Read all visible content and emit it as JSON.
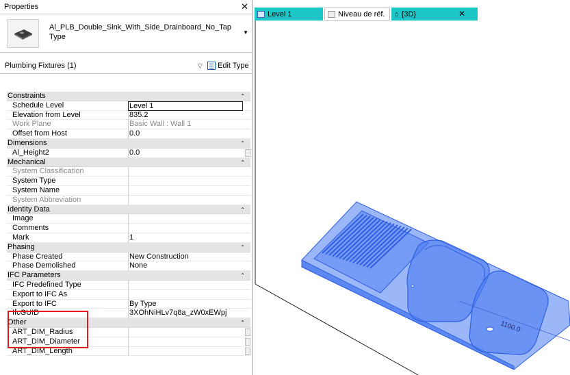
{
  "properties": {
    "title": "Properties",
    "close": "✕",
    "type_name": "Al_PLB_Double_Sink_With_Side_Drainboard_No_Tap",
    "type_sub": "Type",
    "filter": "Plumbing Fixtures (1)",
    "edit_type": "Edit Type",
    "groups": [
      {
        "name": "Constraints",
        "rows": [
          {
            "label": "Schedule Level",
            "value": "Level 1",
            "editing": true
          },
          {
            "label": "Elevation from Level",
            "value": "835.2"
          },
          {
            "label": "Work Plane",
            "value": "Basic Wall : Wall 1",
            "disabled": true
          },
          {
            "label": "Offset from Host",
            "value": "0.0"
          }
        ]
      },
      {
        "name": "Dimensions",
        "rows": [
          {
            "label": "Al_Height2",
            "value": "0.0",
            "button": true
          }
        ]
      },
      {
        "name": "Mechanical",
        "rows": [
          {
            "label": "System Classification",
            "value": "",
            "disabled": true
          },
          {
            "label": "System Type",
            "value": ""
          },
          {
            "label": "System Name",
            "value": ""
          },
          {
            "label": "System Abbreviation",
            "value": "",
            "disabled": true
          }
        ]
      },
      {
        "name": "Identity Data",
        "rows": [
          {
            "label": "Image",
            "value": ""
          },
          {
            "label": "Comments",
            "value": ""
          },
          {
            "label": "Mark",
            "value": "1"
          }
        ]
      },
      {
        "name": "Phasing",
        "rows": [
          {
            "label": "Phase Created",
            "value": "New Construction"
          },
          {
            "label": "Phase Demolished",
            "value": "None"
          }
        ]
      },
      {
        "name": "IFC Parameters",
        "rows": [
          {
            "label": "IFC Predefined Type",
            "value": ""
          },
          {
            "label": "Export to IFC As",
            "value": ""
          },
          {
            "label": "Export to IFC",
            "value": "By Type"
          },
          {
            "label": "IfcGUID",
            "value": "3XOhNiHLv7q8a_zW0xEWpj"
          }
        ]
      },
      {
        "name": "Other",
        "rows": [
          {
            "label": "ART_DIM_Radius",
            "value": "",
            "button": true
          },
          {
            "label": "ART_DIM_Diameter",
            "value": "",
            "button": true
          },
          {
            "label": "ART_DIM_Length",
            "value": "",
            "button": true
          }
        ]
      }
    ]
  },
  "tabs": [
    {
      "label": "Level 1"
    },
    {
      "label": "Niveau de réf."
    },
    {
      "label": "{3D}"
    }
  ],
  "tab_close": "✕",
  "viewport": {
    "dimension_text": "1100.0",
    "model_color": "#2f5fe0",
    "model_fill": "#4a7bf0"
  },
  "colors": {
    "tab_active": "#1ec7c7",
    "highlight": "#e31b23"
  }
}
